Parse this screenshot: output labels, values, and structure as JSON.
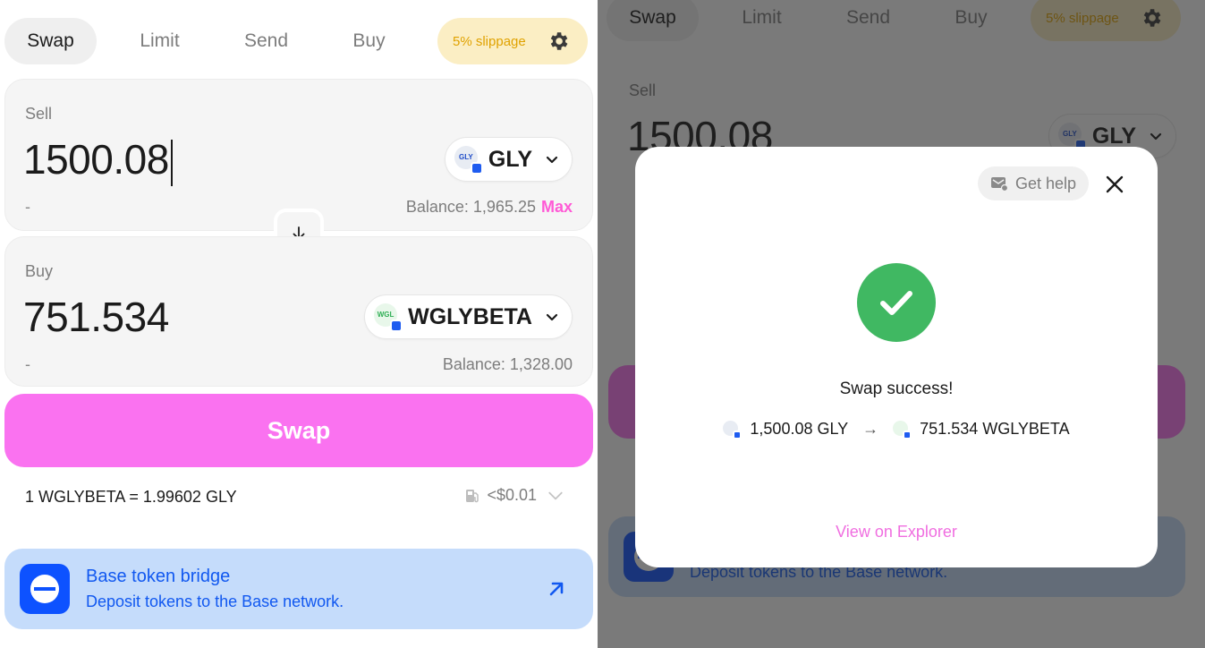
{
  "tabs": {
    "swap": "Swap",
    "limit": "Limit",
    "send": "Send",
    "buy": "Buy",
    "slippage": "5% slippage"
  },
  "sell": {
    "label": "Sell",
    "amount": "1500.08",
    "token": "GLY",
    "token_icon_text": "GLY",
    "usd": "-",
    "balance": "Balance: 1,965.25",
    "max": "Max"
  },
  "buy": {
    "label": "Buy",
    "amount": "751.534",
    "token": "WGLYBETA",
    "token_icon_text": "WGL",
    "usd": "-",
    "balance": "Balance: 1,328.00"
  },
  "swap_button": "Swap",
  "rate": "1 WGLYBETA = 1.99602 GLY",
  "gas": "<$0.01",
  "bridge": {
    "title": "Base token bridge",
    "subtitle": "Deposit tokens to the Base network."
  },
  "modal": {
    "help": "Get help",
    "success": "Swap success!",
    "from": "1,500.08 GLY",
    "arrow": "→",
    "to": "751.534 WGLYBETA",
    "explorer": "View on Explorer"
  },
  "colors": {
    "accent": "#fa72f0",
    "success": "#40b862",
    "slippage_bg": "#fbeec4",
    "bridge_bg": "#c5dcfb",
    "bridge_text": "#1158f0"
  }
}
